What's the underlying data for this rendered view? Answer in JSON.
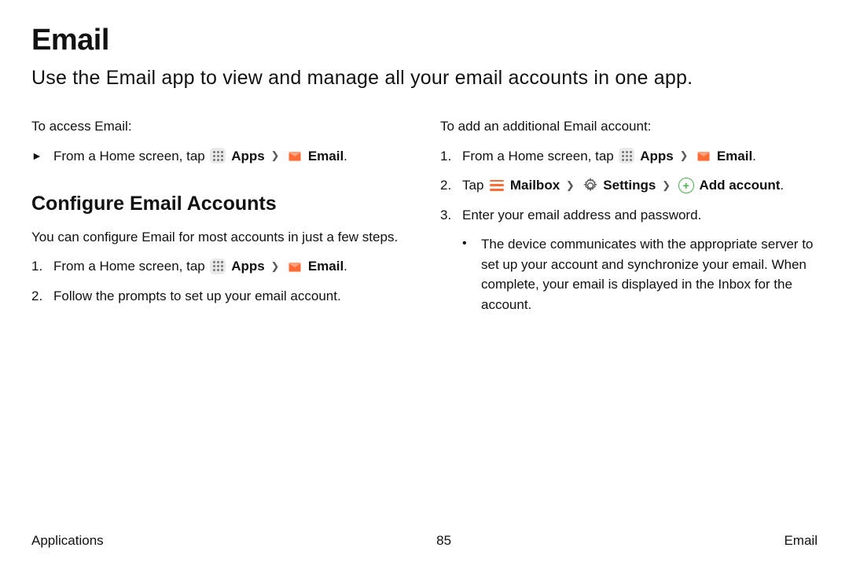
{
  "title": "Email",
  "intro": "Use the Email app to view and manage all your email accounts in one app.",
  "left": {
    "access_lead": "To access Email:",
    "access_step_prefix": "From a Home screen, tap ",
    "apps_label": "Apps",
    "email_label": "Email",
    "configure_heading": "Configure Email Accounts",
    "configure_para": "You can configure Email for most accounts in just a few steps.",
    "step1_prefix": "From a Home screen, tap ",
    "step2": "Follow the prompts to set up your email account."
  },
  "right": {
    "add_lead": "To add an additional Email account:",
    "step1_prefix": "From a Home screen, tap ",
    "apps_label": "Apps",
    "email_label": "Email",
    "step2_tap": "Tap ",
    "mailbox_label": "Mailbox",
    "settings_label": "Settings",
    "add_account_label": "Add account",
    "step3": "Enter your email address and password.",
    "sub_bullet": "The device communicates with the appropriate server to set up your account and synchronize your email. When complete, your email is displayed in the Inbox for the account."
  },
  "footer": {
    "left": "Applications",
    "center": "85",
    "right": "Email"
  },
  "markers": {
    "tri": "►",
    "n1": "1.",
    "n2": "2.",
    "n3": "3.",
    "dot": "•"
  },
  "punct": {
    "period": "."
  }
}
